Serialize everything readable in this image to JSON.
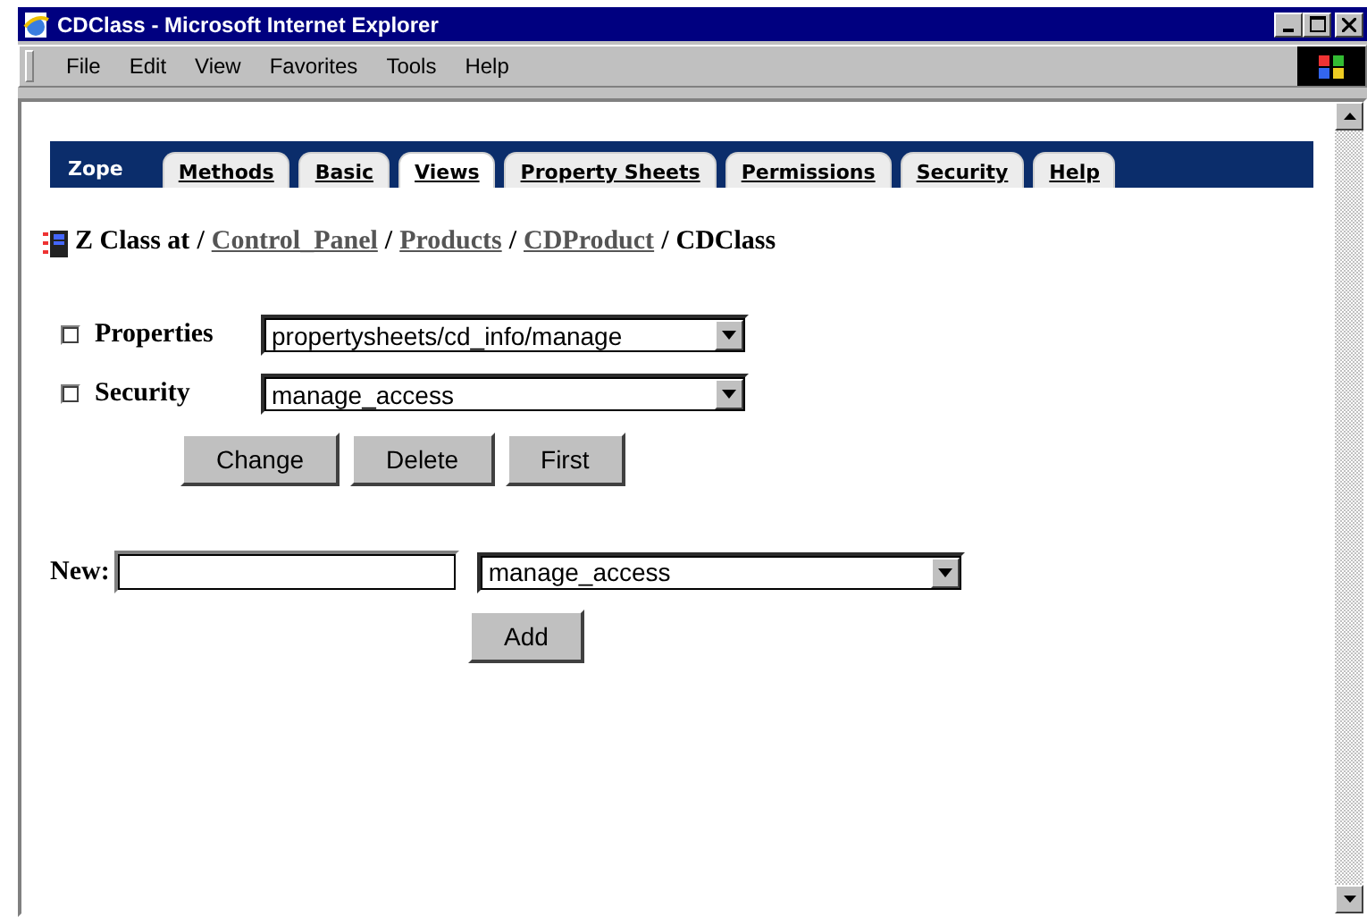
{
  "window": {
    "title": "CDClass - Microsoft Internet Explorer"
  },
  "menu": [
    {
      "label": "File"
    },
    {
      "label": "Edit"
    },
    {
      "label": "View"
    },
    {
      "label": "Favorites"
    },
    {
      "label": "Tools"
    },
    {
      "label": "Help"
    }
  ],
  "tabs": {
    "brand": "Zope",
    "items": [
      {
        "label": "Methods",
        "selected": false
      },
      {
        "label": "Basic",
        "selected": false
      },
      {
        "label": "Views",
        "selected": true
      },
      {
        "label": "Property Sheets",
        "selected": false
      },
      {
        "label": "Permissions",
        "selected": false
      },
      {
        "label": "Security",
        "selected": false
      },
      {
        "label": "Help",
        "selected": false
      }
    ]
  },
  "breadcrumb": {
    "label": "Z Class at",
    "separator": "/",
    "path": [
      {
        "label": "Control_Panel",
        "link": true
      },
      {
        "label": "Products",
        "link": true
      },
      {
        "label": "CDProduct",
        "link": true
      },
      {
        "label": "CDClass",
        "link": false
      }
    ]
  },
  "views": [
    {
      "label": "Properties",
      "checked": false,
      "value": "propertysheets/cd_info/manage"
    },
    {
      "label": "Security",
      "checked": false,
      "value": "manage_access"
    }
  ],
  "view_buttons": [
    "Change",
    "Delete",
    "First"
  ],
  "new": {
    "label": "New:",
    "value": "manage_access",
    "button": "Add"
  }
}
